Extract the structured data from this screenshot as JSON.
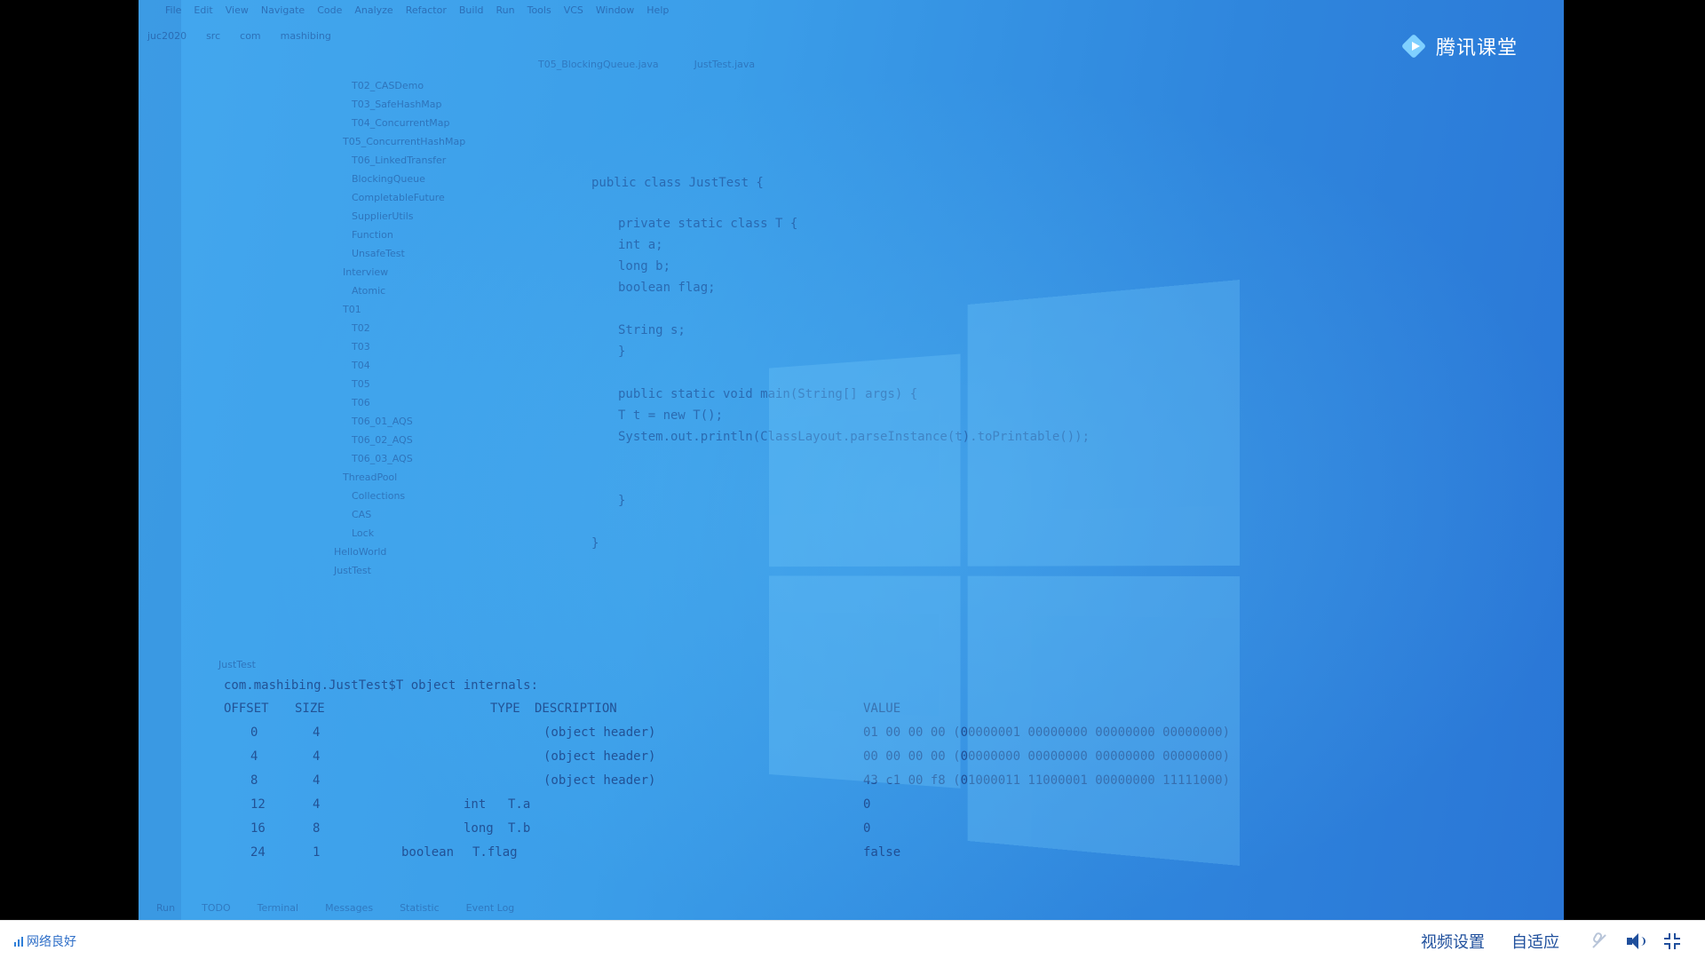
{
  "video_overlay": {
    "menubar": [
      "File",
      "Edit",
      "View",
      "Navigate",
      "Code",
      "Analyze",
      "Refactor",
      "Build",
      "Run",
      "Tools",
      "VCS",
      "Window",
      "Help"
    ],
    "breadcrumbs": [
      "juc2020",
      "src",
      "com",
      "mashibing"
    ],
    "tabs": [
      "T05_BlockingQueue.java",
      "JustTest.java"
    ],
    "project_tree": [
      "T02_CASDemo",
      "T03_SafeHashMap",
      "T04_ConcurrentMap",
      "T05_ConcurrentHashMap",
      "T06_LinkedTransfer",
      "BlockingQueue",
      "CompletableFuture",
      "SupplierUtils",
      "Function",
      "UnsafeTest",
      "Interview",
      "Atomic",
      "T01",
      "T02",
      "T03",
      "T04",
      "T05",
      "T06",
      "T06_01_AQS",
      "T06_02_AQS",
      "T06_03_AQS",
      "ThreadPool",
      "Collections",
      "CAS",
      "Lock",
      "HelloWorld",
      "JustTest"
    ],
    "code_lines": [
      "public class JustTest {",
      "    private static class T {",
      "        int a;",
      "        long b;",
      "        boolean flag;",
      "        String s;",
      "    }",
      "    public static void main(String[] args) {",
      "        T t = new T();",
      "        System.out.println(ClassLayout.parseInstance(t).toPrintable());",
      "    }",
      "}"
    ],
    "run_label": "JustTest",
    "console_header": "com.mashibing.JustTest$T object internals:",
    "table_headers": [
      "OFFSET",
      "SIZE",
      "TYPE",
      "DESCRIPTION",
      "VALUE"
    ],
    "table_rows": [
      {
        "offset": "0",
        "size": "4",
        "type": "",
        "desc": "(object header)",
        "value": "01 00 00 00 (00000001 00000000 00000000 00000000)"
      },
      {
        "offset": "4",
        "size": "4",
        "type": "",
        "desc": "(object header)",
        "value": "00 00 00 00 (00000000 00000000 00000000 00000000)"
      },
      {
        "offset": "8",
        "size": "4",
        "type": "",
        "desc": "(object header)",
        "value": "43 c1 00 f8 (01000011 11000001 00000000 11111000)"
      },
      {
        "offset": "12",
        "size": "4",
        "type": "int",
        "desc": "T.a",
        "value": "0"
      },
      {
        "offset": "16",
        "size": "8",
        "type": "long",
        "desc": "T.b",
        "value": "0"
      },
      {
        "offset": "24",
        "size": "1",
        "type": "boolean",
        "desc": "T.flag",
        "value": "false"
      }
    ],
    "status_items": [
      "Run",
      "TODO",
      "Terminal",
      "Messages",
      "Statistic",
      "Event Log"
    ]
  },
  "brand": {
    "name": "腾讯课堂",
    "icon": "tencent-classroom-play-icon"
  },
  "player_bar": {
    "network_status": "网络良好",
    "video_settings": "视频设置",
    "fit_mode": "自适应",
    "icons": [
      "network-signal-icon",
      "mic-muted-icon",
      "speaker-icon",
      "exit-fullscreen-icon"
    ],
    "accent": "#2f6fc8"
  },
  "colors": {
    "video_bg": "#3b9ee9",
    "player_bar_bg": "#ffffff"
  }
}
